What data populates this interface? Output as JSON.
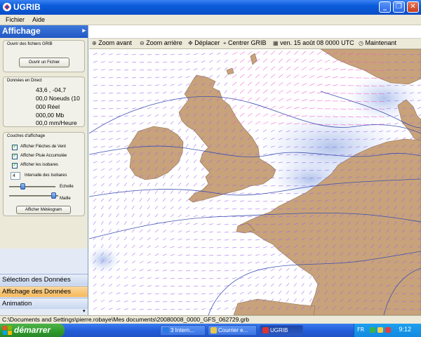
{
  "window": {
    "title": "UGRIB"
  },
  "menu": {
    "file": "Fichier",
    "help": "Aide"
  },
  "panel": {
    "title": "Affichage",
    "grib_group": {
      "title": "Ouvrir des fichiers GRIB",
      "open_button": "Ouvrir un Fichier"
    },
    "live_group": {
      "title": "Données en Direct",
      "lines": [
        "43,6 ,  -04,7",
        "00,0 Noeuds (10",
        "000 Réel",
        "000,00 Mb",
        "00,0 mm/Heure"
      ]
    },
    "layers_group": {
      "title": "Couches d'affichage",
      "checks": [
        "Afficher Flèches de Vent",
        "Afficher Pluie Accumulée",
        "Afficher les isobares"
      ],
      "isobar_interval_value": "4",
      "isobar_interval_label": "Intervalle des Isobares",
      "scale_label": "Echelle",
      "mesh_label": "Maille",
      "meteogram_button": "Afficher Météogram"
    }
  },
  "nav": {
    "items": [
      {
        "label": "Sélection des Données",
        "active": false
      },
      {
        "label": "Affichage des Données",
        "active": true
      },
      {
        "label": "Animation",
        "active": false
      }
    ]
  },
  "toolbar": {
    "zoom_in": "Zoom avant",
    "zoom_out": "Zoom arrière",
    "move": "Déplacer",
    "center": "Centrer GRIB",
    "date": "ven. 15 août 08 0000 UTC",
    "now": "Maintenant"
  },
  "status": {
    "path": "C:\\Documents and Settings\\pierre.robaye\\Mes documents\\20080008_0000_GFS_062729.grb"
  },
  "taskbar": {
    "start": "démarrer",
    "tasks": [
      "3 Intern...",
      "Courrier e...",
      "UGRIB"
    ],
    "lang": "FR",
    "clock": "9:12"
  },
  "colors": {
    "land": "#c8a27a",
    "sea": "#ffffff",
    "isobar": "#3d4fb0",
    "wind_low": "#9966ee",
    "wind_high": "#ee55cc",
    "rain": "#b9c8ee"
  }
}
